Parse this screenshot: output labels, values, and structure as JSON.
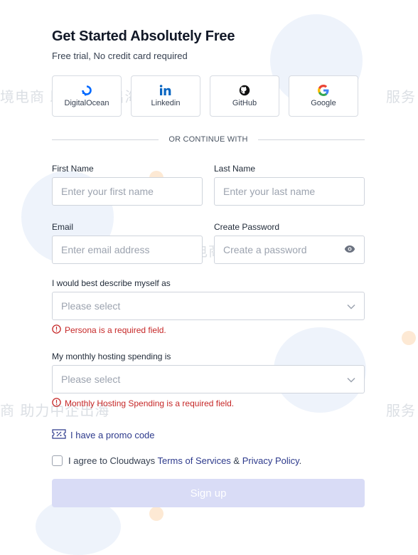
{
  "watermark": {
    "cjk_text_1": "境电商 助力中企出海",
    "cjk_text_2": "服务",
    "cjk_text_3": "服务跨境电商 助力中企出海",
    "cjk_text_4": "商 助力中企出海",
    "cjk_text_5": "服务"
  },
  "header": {
    "title": "Get Started Absolutely Free",
    "subtitle": "Free trial, No credit card required"
  },
  "providers": [
    {
      "label": "DigitalOcean",
      "icon": "digitalocean-icon"
    },
    {
      "label": "Linkedin",
      "icon": "linkedin-icon"
    },
    {
      "label": "GitHub",
      "icon": "github-icon"
    },
    {
      "label": "Google",
      "icon": "google-icon"
    }
  ],
  "divider": "OR CONTINUE WITH",
  "form": {
    "first_name": {
      "label": "First Name",
      "placeholder": "Enter your first name"
    },
    "last_name": {
      "label": "Last Name",
      "placeholder": "Enter your last name"
    },
    "email": {
      "label": "Email",
      "placeholder": "Enter email address"
    },
    "password": {
      "label": "Create Password",
      "placeholder": "Create a password"
    },
    "persona": {
      "label": "I would best describe myself as",
      "value": "Please select",
      "error": "Persona is a required field."
    },
    "spending": {
      "label": "My monthly hosting spending is",
      "value": "Please select",
      "error": "Monthly Hosting Spending is a required field."
    },
    "promo": "I have a promo code",
    "agree": {
      "prefix": "I agree to Cloudways ",
      "terms": "Terms of Services",
      "amp": " & ",
      "privacy": "Privacy Policy",
      "suffix": "."
    },
    "submit": "Sign up"
  },
  "colors": {
    "accent": "#2d3a8c",
    "error": "#c62828",
    "button_disabled": "#d9dcf6"
  }
}
